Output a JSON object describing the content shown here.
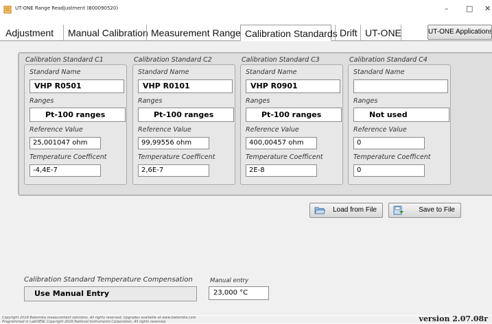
{
  "window": {
    "title": "UT-ONE Range Readjustment (B00090520)",
    "minimize": "–",
    "maximize": "□",
    "close": "✕"
  },
  "tabs": [
    "Adjustment",
    "Manual Calibration",
    "Measurement Ranges",
    "Calibration Standards",
    "Drift",
    "UT-ONE"
  ],
  "active_tab": "Calibration Standards",
  "apps_button": "UT-ONE Applications",
  "labels": {
    "standard_name": "Standard Name",
    "ranges": "Ranges",
    "reference_value": "Reference Value",
    "temperature_coefficient": "Temperature Coefficent"
  },
  "standards": [
    {
      "title": "Calibration Standard C1",
      "name": "VHP R0501",
      "range": "Pt-100 ranges",
      "reference_value": "25,001047 ohm",
      "temp_coeff": "-4,4E-7"
    },
    {
      "title": "Calibration Standard C2",
      "name": "VHP R0101",
      "range": "Pt-100 ranges",
      "reference_value": "99,99556 ohm",
      "temp_coeff": "2,6E-7"
    },
    {
      "title": "Calibration Standard C3",
      "name": "VHP R0901",
      "range": "Pt-100 ranges",
      "reference_value": "400,00457 ohm",
      "temp_coeff": "2E-8"
    },
    {
      "title": "Calibration Standard C4",
      "name": "",
      "range": "Not used",
      "reference_value": "0",
      "temp_coeff": "0"
    }
  ],
  "buttons": {
    "load": "Load from File",
    "save": "Save to File"
  },
  "compensation": {
    "title": "Calibration Standard Temperature Compensation",
    "value": "Use Manual Entry",
    "manual_label": "Manual entry",
    "manual_value": "23,000 °C"
  },
  "footer": {
    "copyright_line1": "Copyright 2016 Batemika measurement solutions. All rights reserved. Upgrades available at www.batemika.com",
    "copyright_line2": "Programmed in LabVIEW, Copyright 2016 National Instruments Corporation. All rights reserved.",
    "version": "version 2.07.08r"
  },
  "colors": {
    "panel_bg": "#f0f0f0",
    "group_bg": "#dedede",
    "app_icon": "#e0a030"
  }
}
